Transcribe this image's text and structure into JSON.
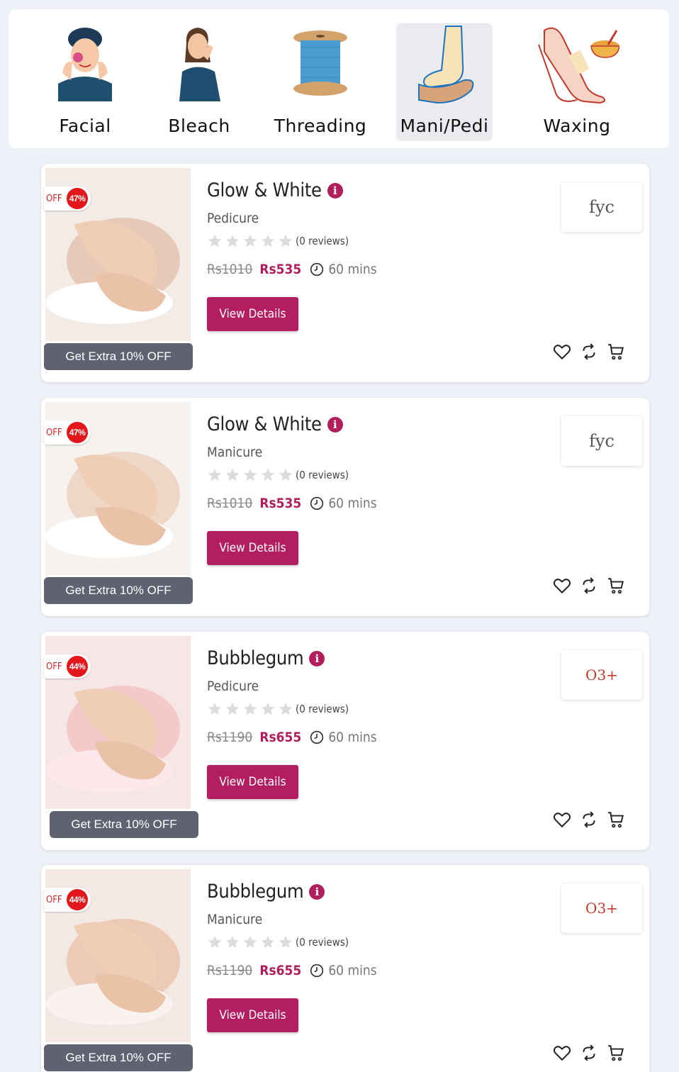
{
  "categories": [
    {
      "label": "Facial",
      "icon": "facial-icon",
      "active": false
    },
    {
      "label": "Bleach",
      "icon": "bleach-icon",
      "active": false
    },
    {
      "label": "Threading",
      "icon": "threading-icon",
      "active": false
    },
    {
      "label": "Mani/Pedi",
      "icon": "mani-pedi-icon",
      "active": true
    },
    {
      "label": "Waxing",
      "icon": "waxing-icon",
      "active": false
    }
  ],
  "cards": [
    {
      "title": "Glow & White",
      "subtitle": "Pedicure",
      "off_label": "OFF",
      "discount": "47%",
      "reviews": "(0 reviews)",
      "old_price": "Rs1010",
      "new_price": "Rs535",
      "duration": "60 mins",
      "view_label": "View Details",
      "extra_label": "Get Extra 10% OFF",
      "brand": "fyc",
      "rating": 0
    },
    {
      "title": "Glow & White",
      "subtitle": "Manicure",
      "off_label": "OFF",
      "discount": "47%",
      "reviews": "(0 reviews)",
      "old_price": "Rs1010",
      "new_price": "Rs535",
      "duration": "60 mins",
      "view_label": "View Details",
      "extra_label": "Get Extra 10% OFF",
      "brand": "fyc",
      "rating": 0
    },
    {
      "title": "Bubblegum",
      "subtitle": "Pedicure",
      "off_label": "OFF",
      "discount": "44%",
      "reviews": "(0 reviews)",
      "old_price": "Rs1190",
      "new_price": "Rs655",
      "duration": "60 mins",
      "view_label": "View Details",
      "extra_label": "Get Extra 10% OFF",
      "brand": "O3+",
      "rating": 0
    },
    {
      "title": "Bubblegum",
      "subtitle": "Manicure",
      "off_label": "OFF",
      "discount": "44%",
      "reviews": "(0 reviews)",
      "old_price": "Rs1190",
      "new_price": "Rs655",
      "duration": "60 mins",
      "view_label": "View Details",
      "extra_label": "Get Extra 10% OFF",
      "brand": "O3+",
      "rating": 0
    }
  ],
  "colors": {
    "accent": "#b31e62",
    "discount_red": "#e3161b",
    "extra_button": "#5f6270",
    "background": "#eef1f7"
  }
}
